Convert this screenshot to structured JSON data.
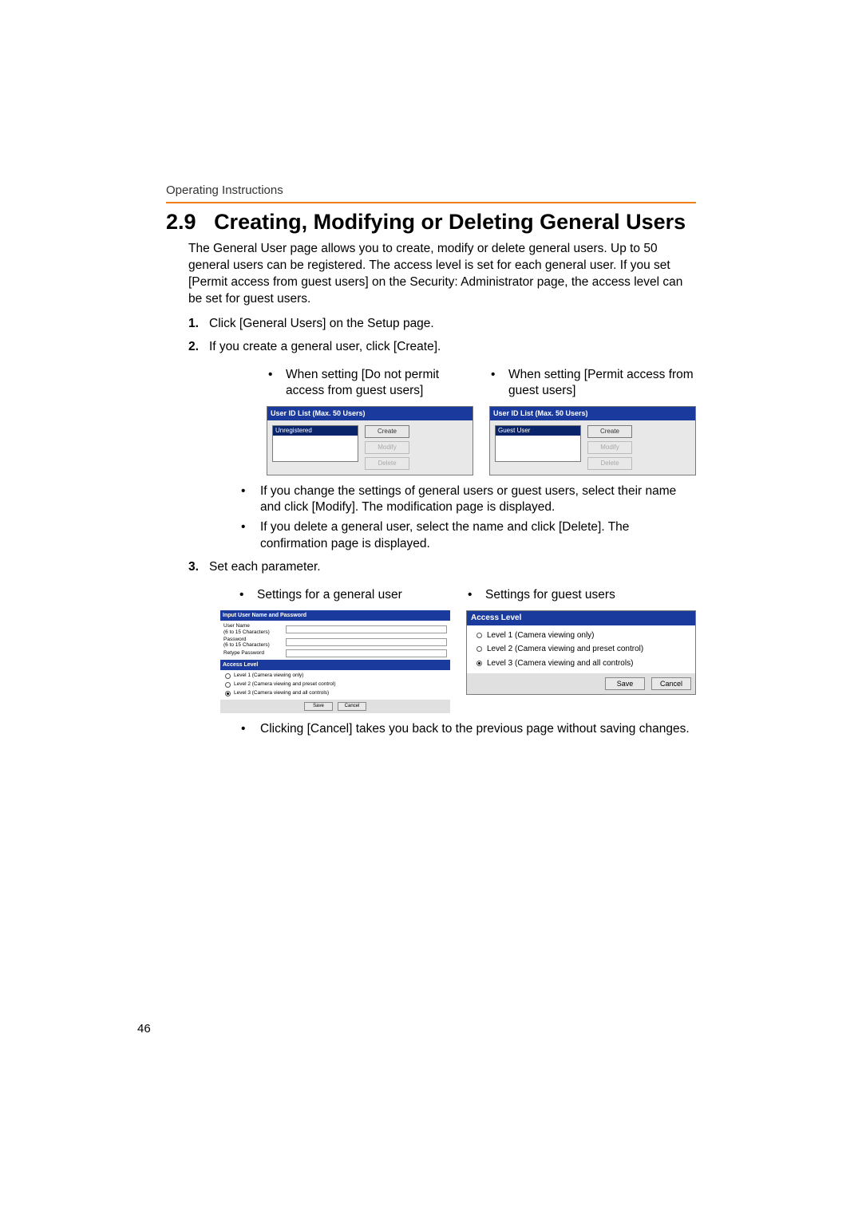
{
  "header_label": "Operating Instructions",
  "heading_num": "2.9",
  "heading_title": "Creating, Modifying or Deleting General Users",
  "intro": "The General User page allows you to create, modify or delete general users. Up to 50 general users can be registered. The access level is set for each general user. If you set [Permit access from guest users] on the Security: Administrator page, the access level can be set for guest users.",
  "step1": "Click [General Users] on the Setup page.",
  "step2": "If you create a general user, click [Create].",
  "cap_left": "When setting [Do not permit access from guest users]",
  "cap_right": "When setting [Permit access from guest users]",
  "panel_header": "User ID List (Max. 50 Users)",
  "list_left_item": "Unregistered",
  "list_right_item": "Guest User",
  "btn_create": "Create",
  "btn_modify": "Modify",
  "btn_delete": "Delete",
  "note_modify": "If you change the settings of general users or guest users, select their name and click [Modify]. The modification page is displayed.",
  "note_delete": "If you delete a general user, select the name and click [Delete]. The confirmation page is displayed.",
  "step3": "Set each parameter.",
  "cap_general": "Settings for a general user",
  "cap_guest": "Settings for guest users",
  "form": {
    "header1": "Input User Name and Password",
    "username_label": "User Name\n(6 to 15 Characters)",
    "password_label": "Password\n(6 to 15 Characters)",
    "retype_label": "Retype Password",
    "header2": "Access Level",
    "level1": "Level 1 (Camera viewing only)",
    "level2": "Level 2 (Camera viewing and preset control)",
    "level3": "Level 3 (Camera viewing and all controls)",
    "save": "Save",
    "cancel": "Cancel"
  },
  "guest": {
    "header": "Access Level",
    "level1": "Level 1 (Camera viewing only)",
    "level2": "Level 2 (Camera viewing and preset control)",
    "level3": "Level 3 (Camera viewing and all controls)",
    "save": "Save",
    "cancel": "Cancel"
  },
  "note_cancel": "Clicking [Cancel] takes you back to the previous page without saving changes.",
  "page_num": "46"
}
